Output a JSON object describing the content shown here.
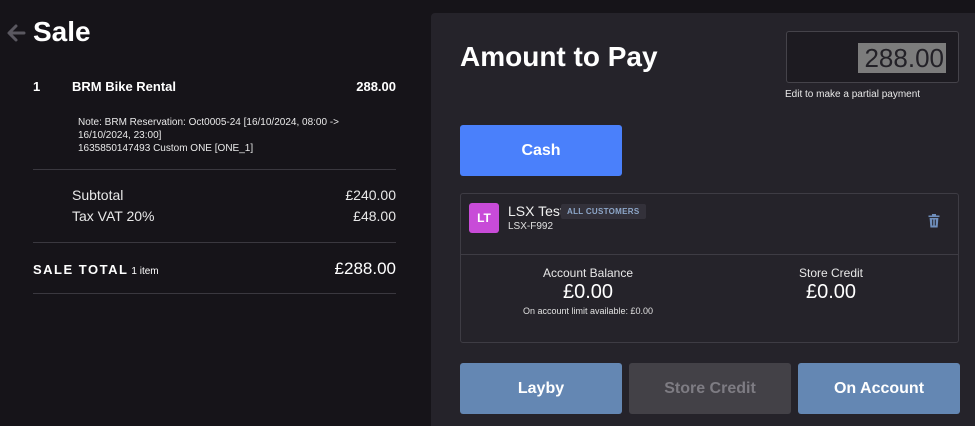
{
  "sale": {
    "title": "Sale",
    "line": {
      "qty": "1",
      "name": "BRM Bike Rental",
      "price": "288.00",
      "note_line1": "Note: BRM Reservation: Oct0005-24 [16/10/2024, 08:00 ->",
      "note_line2": "16/10/2024, 23:00]",
      "note_line3": "1635850147493 Custom ONE [ONE_1]"
    },
    "subtotal_label": "Subtotal",
    "subtotal_value": "£240.00",
    "tax_label": "Tax VAT 20%",
    "tax_value": "£48.00",
    "total_label": "SALE TOTAL",
    "total_items": "1 item",
    "total_value": "£288.00"
  },
  "payment": {
    "title": "Amount to Pay",
    "amount": "288.00",
    "hint": "Edit to make a partial payment",
    "cash_label": "Cash",
    "customer": {
      "initials": "LT",
      "name": "LSX Test",
      "badge": "ALL CUSTOMERS",
      "code": "LSX-F992"
    },
    "account_balance_label": "Account Balance",
    "account_balance_value": "£0.00",
    "account_limit_text": "On account limit available: £0.00",
    "store_credit_label": "Store Credit",
    "store_credit_value": "£0.00",
    "buttons": {
      "layby": "Layby",
      "store_credit": "Store Credit",
      "on_account": "On Account"
    }
  },
  "colors": {
    "background": "#161419",
    "panel": "#25232a",
    "primary": "#4a80fb",
    "secondary": "#6487b3",
    "disabled": "#434147",
    "avatar": "#c84bd8"
  },
  "icons": [
    "back-arrow-icon",
    "trash-icon"
  ]
}
